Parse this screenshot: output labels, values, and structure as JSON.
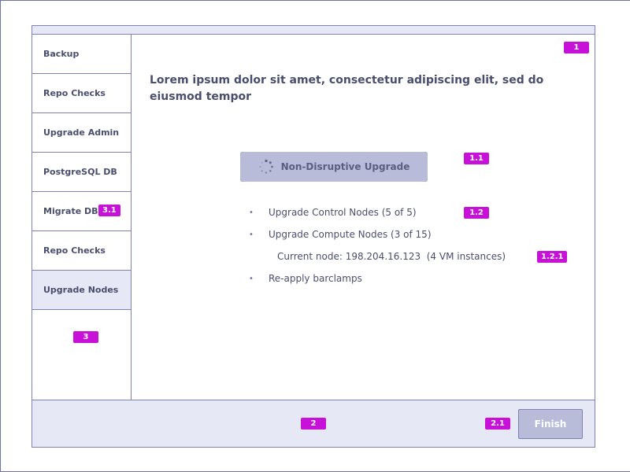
{
  "sidebar": {
    "items": [
      {
        "label": "Backup"
      },
      {
        "label": "Repo Checks"
      },
      {
        "label": "Upgrade Admin"
      },
      {
        "label": "PostgreSQL DB"
      },
      {
        "label": "Migrate DB"
      },
      {
        "label": "Repo Checks"
      },
      {
        "label": "Upgrade Nodes"
      }
    ]
  },
  "main": {
    "headline": "Lorem ipsum dolor sit amet, consectetur adipiscing elit, sed do eiusmod tempor",
    "upgrade_button_label": "Non-Disruptive Upgrade",
    "steps": [
      {
        "text": "Upgrade Control Nodes (5 of 5)"
      },
      {
        "text": "Upgrade Compute Nodes (3 of 15)"
      },
      {
        "text": "Re-apply barclamps"
      }
    ],
    "current_node": "Current node: 198.204.16.123  (4 VM instances)"
  },
  "footer": {
    "finish_label": "Finish"
  },
  "annotations": {
    "b1": "1",
    "b1_1": "1.1",
    "b1_2": "1.2",
    "b1_2_1": "1.2.1",
    "b2": "2",
    "b2_1": "2.1",
    "b3": "3",
    "b3_1": "3.1"
  },
  "colors": {
    "accent_badge": "#c811d8",
    "panel_bg": "#e6e8f5",
    "border": "#7d82b3",
    "button_disabled": "#b9bcd9",
    "text": "#4a4e6e"
  }
}
